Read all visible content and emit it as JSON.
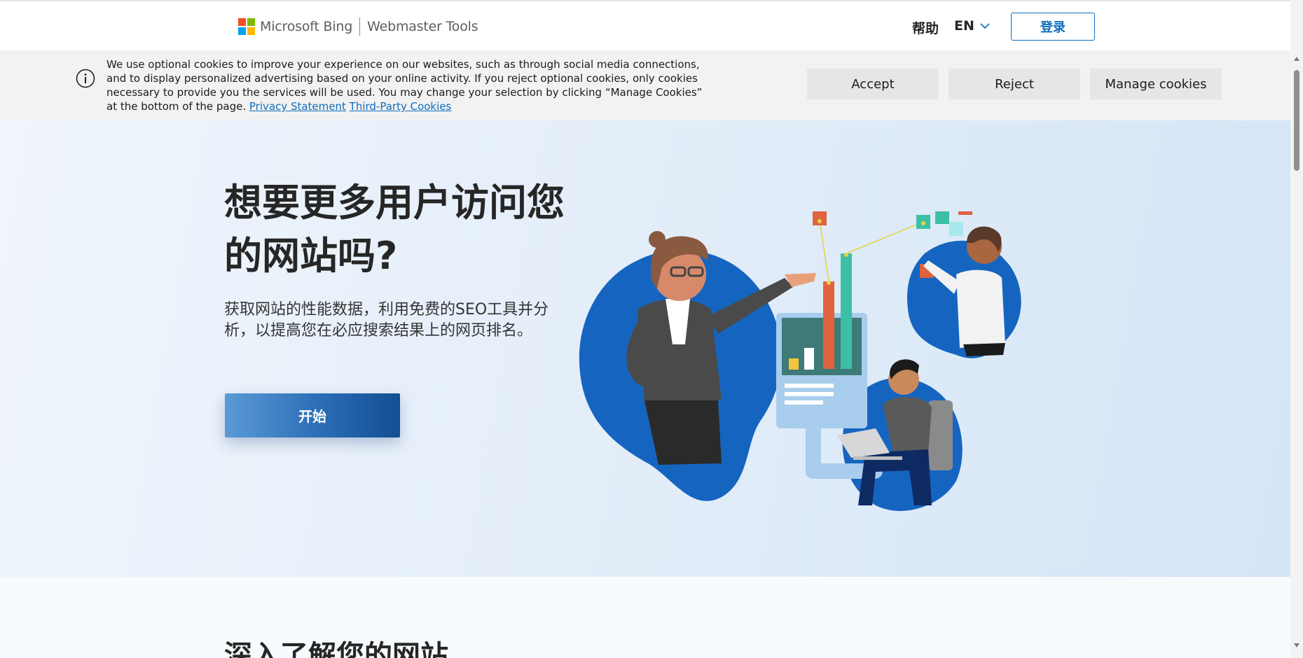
{
  "header": {
    "brand_name": "Microsoft Bing",
    "product_name": "Webmaster Tools",
    "help_label": "帮助",
    "language_label": "EN",
    "login_label": "登录",
    "logo_colors": [
      "#f25022",
      "#7fba00",
      "#00a4ef",
      "#ffb900"
    ]
  },
  "cookie_banner": {
    "message": "We use optional cookies to improve your experience on our websites, such as through social media connections, and to display personalized advertising based on your online activity. If you reject optional cookies, only cookies necessary to provide you the services will be used. You may change your selection by clicking “Manage Cookies” at the bottom of the page.",
    "privacy_link": "Privacy Statement",
    "third_party_link": "Third-Party Cookies",
    "accept_label": "Accept",
    "reject_label": "Reject",
    "manage_label": "Manage cookies",
    "icon": "info-icon"
  },
  "hero": {
    "title": "想要更多用户访问您的网站吗?",
    "description": "获取网站的性能数据，利用免费的SEO工具并分析，以提高您在必应搜索结果上的网页排名。",
    "cta_label": "开始",
    "accent_color": "#0f6cbd"
  },
  "section2": {
    "title": "深入了解您的网站"
  }
}
